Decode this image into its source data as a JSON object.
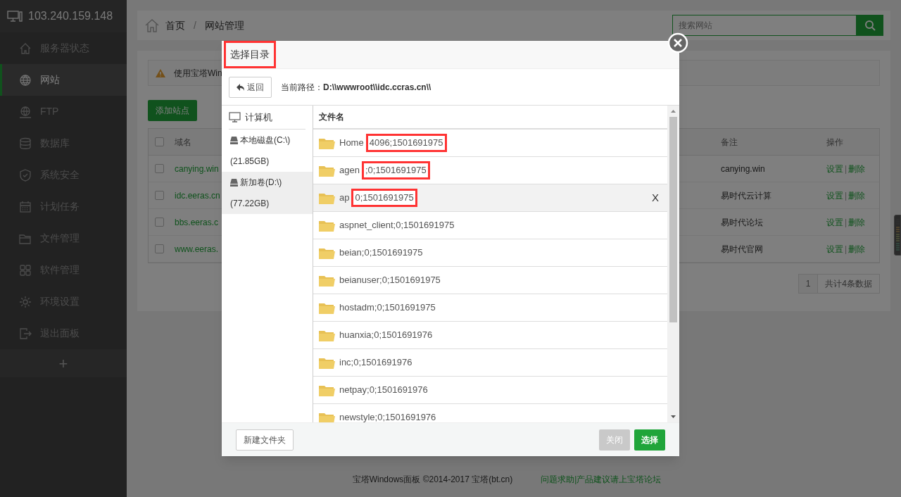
{
  "sidebar": {
    "server": "103.240.159.148",
    "items": [
      {
        "label": "服务器状态",
        "kind": "home",
        "selected": false
      },
      {
        "label": "网站",
        "kind": "globe",
        "selected": true
      },
      {
        "label": "FTP",
        "kind": "ftp",
        "selected": false
      },
      {
        "label": "数据库",
        "kind": "database",
        "selected": false
      },
      {
        "label": "系统安全",
        "kind": "shield",
        "selected": false
      },
      {
        "label": "计划任务",
        "kind": "calendar",
        "selected": false
      },
      {
        "label": "文件管理",
        "kind": "folder",
        "selected": false
      },
      {
        "label": "软件管理",
        "kind": "grid",
        "selected": false
      },
      {
        "label": "环境设置",
        "kind": "gear",
        "selected": false
      },
      {
        "label": "退出面板",
        "kind": "logout",
        "selected": false
      }
    ],
    "add": "+"
  },
  "breadcrumb": [
    "首页",
    "/",
    "网站管理"
  ],
  "search": {
    "placeholder": "搜索网站"
  },
  "notice": "使用宝塔Win",
  "add_site_button": "添加站点",
  "table": {
    "columns": [
      "域名",
      "备注",
      "操作"
    ],
    "all_checked": false,
    "rows": [
      {
        "checked": false,
        "domain": "canying.win",
        "note": "canying.win",
        "actions": [
          "设置",
          "|",
          "删除"
        ]
      },
      {
        "checked": false,
        "domain": "idc.eeras.cn",
        "note": "易时代云计算",
        "actions": [
          "设置",
          "|",
          "删除"
        ]
      },
      {
        "checked": false,
        "domain": "bbs.eeras.c",
        "note": "易时代论坛",
        "actions": [
          "设置",
          "|",
          "删除"
        ]
      },
      {
        "checked": false,
        "domain": "www.eeras.",
        "note": "易时代官网",
        "actions": [
          "设置",
          "|",
          "删除"
        ]
      }
    ]
  },
  "pagination": {
    "page": "1",
    "total": "共计4条数据"
  },
  "footer": {
    "copyright": "宝塔Windows面板 ©2014-2017 宝塔(bt.cn)",
    "link": "问题求助|产品建议请上宝塔论坛"
  },
  "dialog": {
    "title": "选择目录",
    "title_highlighted": true,
    "back_button": "返回",
    "path": "当前路径：**D:\\\\wwwroot\\\\idc.ccras.cn\\\\**",
    "places": [
      {
        "label": "计算机",
        "kind": "computer",
        "selected": false
      },
      {
        "label": "本地磁盘(C:\\)",
        "size": "(21.85GB)",
        "kind": "drive",
        "selected": false
      },
      {
        "label": "新加卷(D:\\)",
        "size": "(77.22GB)",
        "kind": "drive",
        "selected": true
      }
    ],
    "list_header": "文件名",
    "files": [
      {
        "name": "Home",
        "boxed": "4096;1501691975",
        "selected": false
      },
      {
        "name": "agen",
        "boxed": ";0;1501691975",
        "selected": false
      },
      {
        "name": "ap",
        "boxed": "0;1501691975",
        "selected": true,
        "action": "X"
      },
      {
        "name": "aspnet_client;0;1501691975",
        "selected": false
      },
      {
        "name": "beian;0;1501691975",
        "selected": false
      },
      {
        "name": "beianuser;0;1501691975",
        "selected": false
      },
      {
        "name": "hostadm;0;1501691975",
        "selected": false
      },
      {
        "name": "huanxia;0;1501691976",
        "selected": false
      },
      {
        "name": "inc;0;1501691976",
        "selected": false
      },
      {
        "name": "netpay;0;1501691976",
        "selected": false
      },
      {
        "name": "newstyle;0;1501691976",
        "selected": false
      }
    ],
    "new_folder_button": "新建文件夹",
    "close_button": {
      "label": "关闭",
      "disabled": true
    },
    "select_button": "选择"
  }
}
